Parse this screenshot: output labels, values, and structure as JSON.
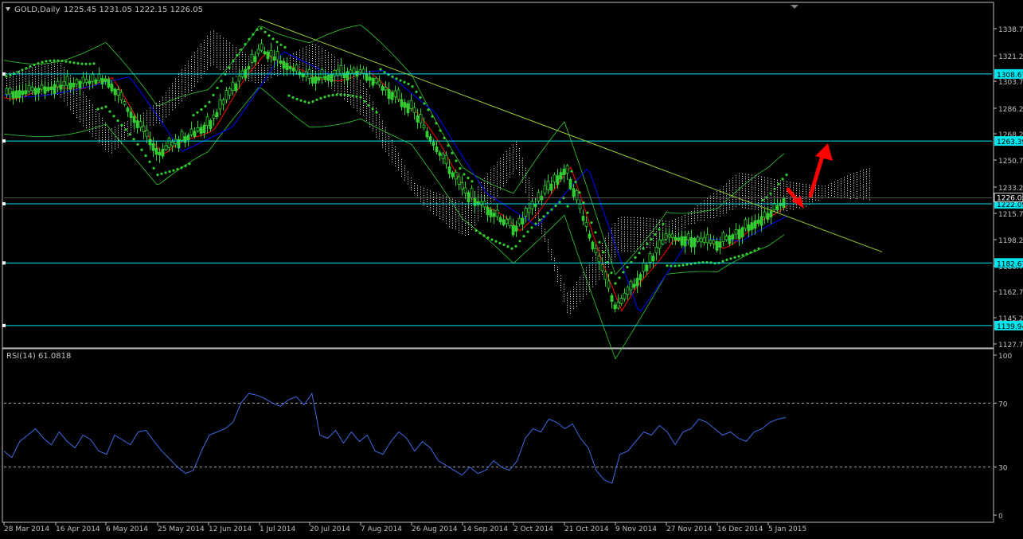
{
  "header": {
    "symbol_label": "GOLD,Daily",
    "ohlc": "1225.45 1231.05 1222.15 1226.05"
  },
  "rsi_panel": {
    "label": "RSI(14) 61.0818"
  },
  "colors": {
    "background": "#000000",
    "axis": "#c0c0c0",
    "candle": "#32cd32",
    "hline": "#00e5ee",
    "trendline": "#9acd32",
    "bollinger": "#32cd32",
    "red_ma": "#ff0000",
    "blue_ma": "#0000ff",
    "psar": "#32cd32",
    "ichimoku_cloud": "#ffffff",
    "rsi_line": "#4169e1",
    "arrow": "#ff0000",
    "level_label_bg": "#00e5ee"
  },
  "chart_data": [
    {
      "type": "line",
      "title": "GOLD,Daily",
      "y_ticks": [
        "1338.70",
        "1321.20",
        "1303.70",
        "1286.20",
        "1268.20",
        "1250.70",
        "1233.20",
        "1215.70",
        "1198.20",
        "1180.70",
        "1162.70",
        "1145.20",
        "1127.70"
      ],
      "x_ticks": [
        "28 Mar 2014",
        "16 Apr 2014",
        "6 May 2014",
        "25 May 2014",
        "12 Jun 2014",
        "1 Jul 2014",
        "20 Jul 2014",
        "7 Aug 2014",
        "26 Aug 2014",
        "14 Sep 2014",
        "2 Oct 2014",
        "21 Oct 2014",
        "9 Nov 2014",
        "27 Nov 2014",
        "16 Dec 2014",
        "5 Jan 2015"
      ],
      "ylim": [
        1125,
        1348
      ],
      "current_price": "1226.05",
      "horizontal_levels": [
        {
          "label": "1308.67",
          "value": 1308.67
        },
        {
          "label": "1263.39",
          "value": 1263.39
        },
        {
          "label": "1222.09",
          "value": 1222.09
        },
        {
          "label": "1182.67",
          "value": 1182.67
        },
        {
          "label": "1139.94",
          "value": 1139.94
        }
      ],
      "trendline": [
        {
          "x": "1 Jul 2014",
          "y": 1345
        },
        {
          "x": "15 Jan 2015",
          "y": 1190
        }
      ],
      "close_approx": [
        {
          "x": "28 Mar 2014",
          "y": 1295
        },
        {
          "x": "16 Apr 2014",
          "y": 1300
        },
        {
          "x": "6 May 2014",
          "y": 1305
        },
        {
          "x": "25 May 2014",
          "y": 1255
        },
        {
          "x": "12 Jun 2014",
          "y": 1275
        },
        {
          "x": "1 Jul 2014",
          "y": 1325
        },
        {
          "x": "20 Jul 2014",
          "y": 1305
        },
        {
          "x": "7 Aug 2014",
          "y": 1310
        },
        {
          "x": "26 Aug 2014",
          "y": 1285
        },
        {
          "x": "14 Sep 2014",
          "y": 1230
        },
        {
          "x": "2 Oct 2014",
          "y": 1205
        },
        {
          "x": "21 Oct 2014",
          "y": 1245
        },
        {
          "x": "9 Nov 2014",
          "y": 1150
        },
        {
          "x": "27 Nov 2014",
          "y": 1200
        },
        {
          "x": "16 Dec 2014",
          "y": 1195
        },
        {
          "x": "5 Jan 2015",
          "y": 1215
        },
        {
          "x": "12 Jan 2015",
          "y": 1226
        }
      ]
    },
    {
      "type": "line",
      "title": "RSI(14) 61.0818",
      "y_ticks": [
        "100",
        "70",
        "30",
        "0"
      ],
      "ylim": [
        0,
        100
      ],
      "reference_levels": [
        70,
        30
      ],
      "series": [
        {
          "values": [
            40,
            36,
            46,
            50,
            54,
            48,
            44,
            52,
            46,
            42,
            50,
            47,
            40,
            38,
            50,
            47,
            44,
            52,
            53,
            46,
            40,
            35,
            30,
            26,
            28,
            40,
            50,
            52,
            54,
            58,
            70,
            76,
            75,
            73,
            70,
            68,
            72,
            74,
            69,
            76,
            50,
            48,
            53,
            45,
            52,
            46,
            50,
            40,
            38,
            46,
            52,
            48,
            40,
            46,
            42,
            34,
            31,
            28,
            25,
            30,
            26,
            28,
            34,
            30,
            28,
            34,
            48,
            54,
            52,
            60,
            58,
            54,
            57,
            48,
            42,
            28,
            22,
            20,
            38,
            40,
            46,
            52,
            50,
            56,
            52,
            44,
            52,
            54,
            60,
            58,
            54,
            50,
            52,
            48,
            46,
            52,
            54,
            58,
            60,
            61
          ]
        }
      ]
    }
  ]
}
